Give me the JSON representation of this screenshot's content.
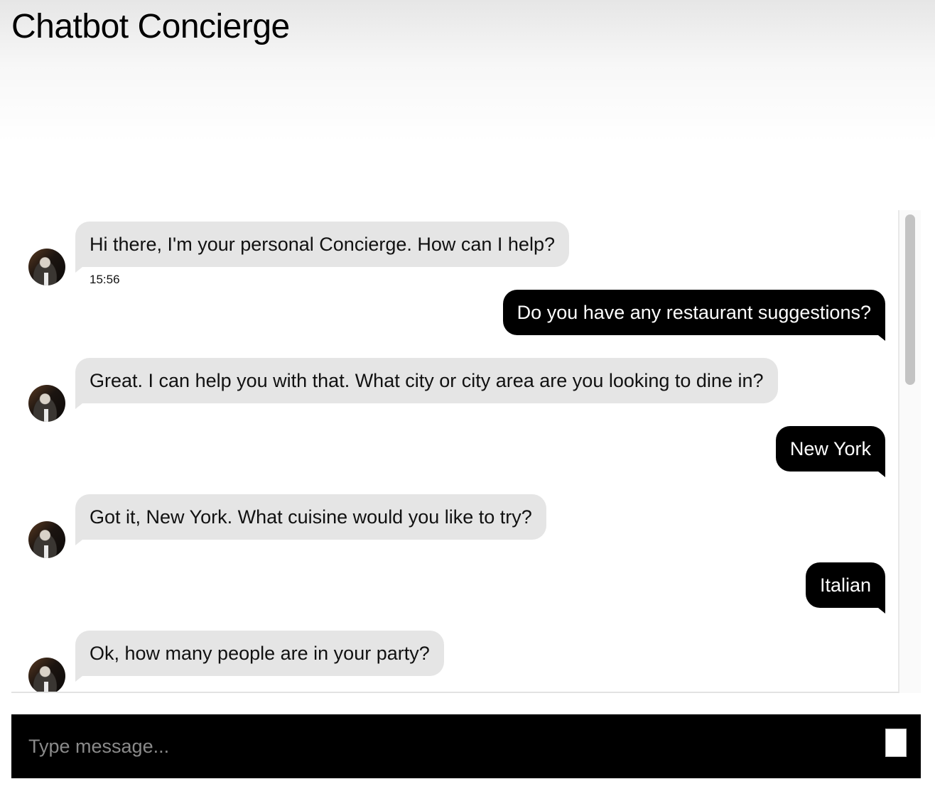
{
  "header": {
    "title": "Chatbot Concierge"
  },
  "messages": [
    {
      "from": "bot",
      "text": "Hi there, I'm your personal Concierge. How can I help?",
      "time": "15:56"
    },
    {
      "from": "user",
      "text": "Do you have any restaurant suggestions?"
    },
    {
      "from": "bot",
      "text": "Great. I can help you with that. What city or city area are you looking to dine in?"
    },
    {
      "from": "user",
      "text": "New York"
    },
    {
      "from": "bot",
      "text": "Got it, New York. What cuisine would you like to try?"
    },
    {
      "from": "user",
      "text": "Italian"
    },
    {
      "from": "bot",
      "text": "Ok, how many people are in your party?"
    }
  ],
  "composer": {
    "placeholder": "Type message..."
  },
  "colors": {
    "bot_bubble": "#e5e5e5",
    "user_bubble": "#000000",
    "input_bar": "#000000"
  }
}
